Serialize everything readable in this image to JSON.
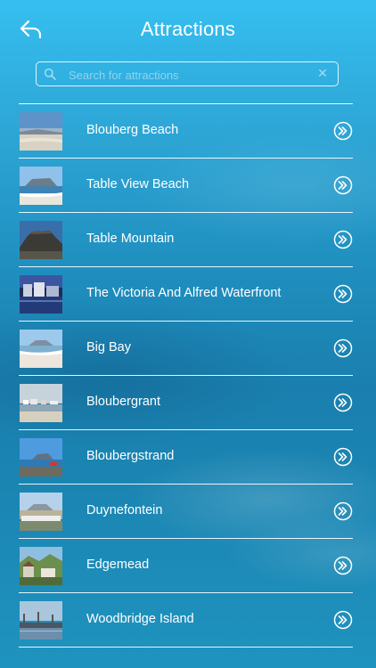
{
  "header": {
    "title": "Attractions",
    "back_icon": "back-arrow-icon"
  },
  "search": {
    "placeholder": "Search for attractions",
    "value": "",
    "icon": "search-icon",
    "clear_icon": "close-icon"
  },
  "list": {
    "items": [
      {
        "label": "Blouberg Beach",
        "thumb": "beach-photo"
      },
      {
        "label": "Table View Beach",
        "thumb": "beach-mountain-photo"
      },
      {
        "label": "Table Mountain",
        "thumb": "mountain-photo"
      },
      {
        "label": "The Victoria And Alfred Waterfront",
        "thumb": "waterfront-photo"
      },
      {
        "label": "Big Bay",
        "thumb": "bay-photo"
      },
      {
        "label": "Bloubergrant",
        "thumb": "coast-town-photo"
      },
      {
        "label": "Bloubergstrand",
        "thumb": "coast-photo"
      },
      {
        "label": "Duynefontein",
        "thumb": "dune-town-photo"
      },
      {
        "label": "Edgemead",
        "thumb": "suburb-photo"
      },
      {
        "label": "Woodbridge Island",
        "thumb": "island-photo"
      }
    ],
    "row_action_icon": "chevron-right-circle-icon"
  },
  "colors": {
    "background_top": "#35bff0",
    "background_mid": "#1a7fae",
    "text": "#ffffff"
  }
}
